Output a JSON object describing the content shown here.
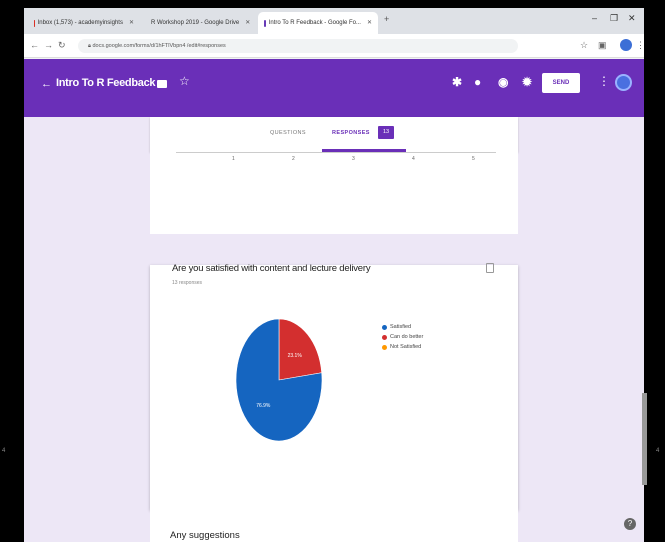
{
  "browser": {
    "tabs": [
      {
        "label": "Inbox (1,573) - academyinsights",
        "color": "#d93025"
      },
      {
        "label": "R Workshop 2019 - Google Drive",
        "color": "#1a73e8"
      },
      {
        "label": "Intro To R Feedback - Google Fo...",
        "color": "#673ab7"
      }
    ],
    "url": "docs.google.com/forms/d/1hFTlVbpn4 /edit#responses"
  },
  "form": {
    "title": "Intro To R Feedback",
    "send_label": "SEND"
  },
  "tabs": {
    "questions": "QUESTIONS",
    "responses": "RESPONSES",
    "response_count": "13"
  },
  "prev_axis_ticks": [
    "1",
    "2",
    "3",
    "4",
    "5"
  ],
  "question": {
    "title": "Are you satisfied with content and lecture delivery",
    "subtitle": "13 responses"
  },
  "chart_data": {
    "type": "pie",
    "categories": [
      "Satisfied",
      "Can do better",
      "Not Satisfied"
    ],
    "values": [
      76.9,
      23.1,
      0
    ],
    "slice_labels": [
      "76.9%",
      "23.1%",
      ""
    ],
    "colors": [
      "#1565c0",
      "#d32f2f",
      "#ff9800"
    ],
    "legend_position": "right"
  },
  "next_question": {
    "title": "Any suggestions"
  }
}
